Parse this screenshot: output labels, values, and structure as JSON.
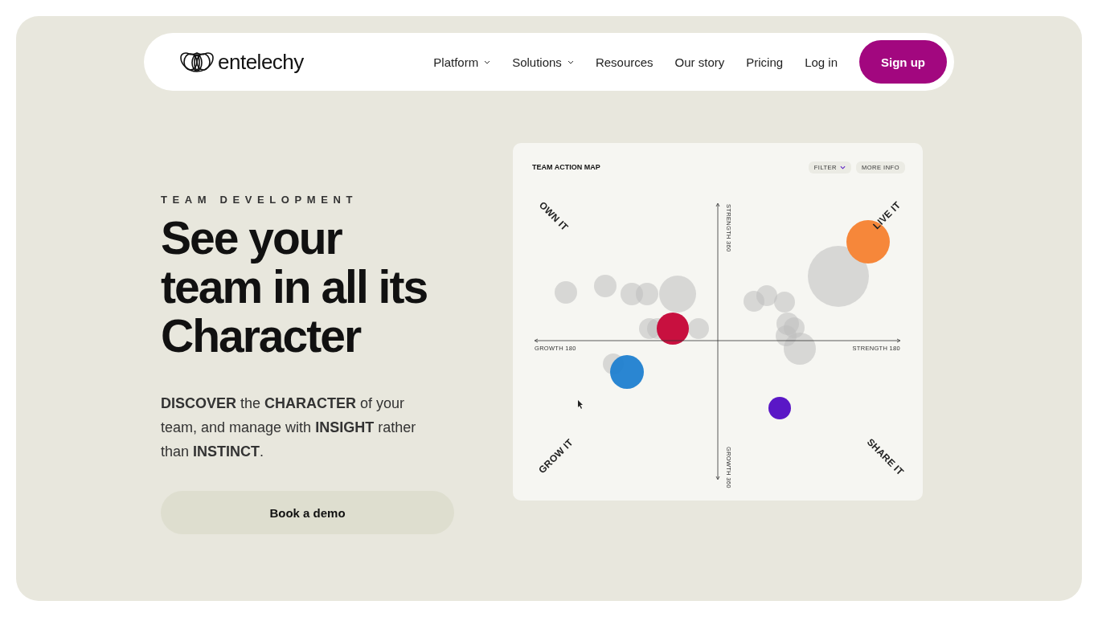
{
  "nav": {
    "logo": "entelechy",
    "items": [
      {
        "label": "Platform",
        "kind": "dropdown"
      },
      {
        "label": "Solutions",
        "kind": "dropdown"
      },
      {
        "label": "Resources",
        "kind": "link"
      },
      {
        "label": "Our story",
        "kind": "link"
      },
      {
        "label": "Pricing",
        "kind": "link"
      },
      {
        "label": "Log in",
        "kind": "link"
      }
    ],
    "cta": "Sign up"
  },
  "hero": {
    "eyebrow": "TEAM DEVELOPMENT",
    "headline_lines": [
      "See your",
      "team in all its",
      "Character"
    ],
    "body": "**DISCOVER** the **CHARACTER** of your team, and manage with **INSIGHT** rather than **INSTINCT**.",
    "button": "Book a demo"
  },
  "map": {
    "title": "TEAM ACTION MAP",
    "filter": "FILTER",
    "more_info": "MORE INFO",
    "quadrants": [
      "OWN IT",
      "LIVE IT",
      "GROW IT",
      "SHARE IT"
    ],
    "axes": {
      "top": "STRENGTH 360",
      "bottom": "GROWTH 360",
      "left": "GROWTH 180",
      "right": "STRENGTH 180"
    }
  }
}
